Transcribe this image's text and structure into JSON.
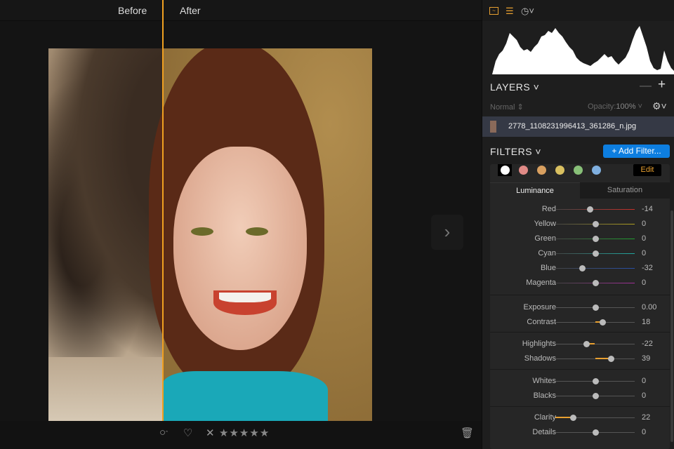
{
  "compare": {
    "before": "Before",
    "after": "After"
  },
  "panel": {
    "layers_title": "LAYERS",
    "blend_mode": "Normal",
    "opacity_label": "Opacity:",
    "opacity_value": "100%",
    "layer_name": "2778_1108231996413_361286_n.jpg",
    "filters_title": "FILTERS",
    "add_filter": "+ Add Filter...",
    "edit": "Edit",
    "color_dots": [
      "#ffffff",
      "#e08a86",
      "#d9a060",
      "#d9c060",
      "#88c078",
      "#80b0e0"
    ],
    "tabs": [
      "Luminance",
      "Saturation"
    ]
  },
  "sliders": [
    {
      "label": "Red",
      "value": -14,
      "display": "-14",
      "min": -100,
      "color": "#c8302a"
    },
    {
      "label": "Yellow",
      "value": 0,
      "display": "0",
      "min": -100,
      "color": "#b0a020"
    },
    {
      "label": "Green",
      "value": 0,
      "display": "0",
      "min": -100,
      "color": "#20a030"
    },
    {
      "label": "Cyan",
      "value": 0,
      "display": "0",
      "min": -100,
      "color": "#20a8a0"
    },
    {
      "label": "Blue",
      "value": -32,
      "display": "-32",
      "min": -100,
      "color": "#2850a8"
    },
    {
      "label": "Magenta",
      "value": 0,
      "display": "0",
      "min": -100,
      "color": "#a03098"
    },
    {
      "label": "Exposure",
      "value": 0,
      "display": "0.00",
      "min": -100,
      "color": ""
    },
    {
      "label": "Contrast",
      "value": 18,
      "display": "18",
      "min": -100,
      "color": ""
    },
    {
      "label": "Highlights",
      "value": -22,
      "display": "-22",
      "min": -100,
      "color": ""
    },
    {
      "label": "Shadows",
      "value": 39,
      "display": "39",
      "min": -100,
      "color": ""
    },
    {
      "label": "Whites",
      "value": 0,
      "display": "0",
      "min": -100,
      "color": ""
    },
    {
      "label": "Blacks",
      "value": 0,
      "display": "0",
      "min": -100,
      "color": ""
    },
    {
      "label": "Clarity",
      "value": 22,
      "display": "22",
      "min": 0,
      "color": ""
    },
    {
      "label": "Details",
      "value": 0,
      "display": "0",
      "min": -100,
      "color": ""
    }
  ],
  "rating": {
    "stars": 0,
    "max": 5
  },
  "accent": "#f0a020"
}
